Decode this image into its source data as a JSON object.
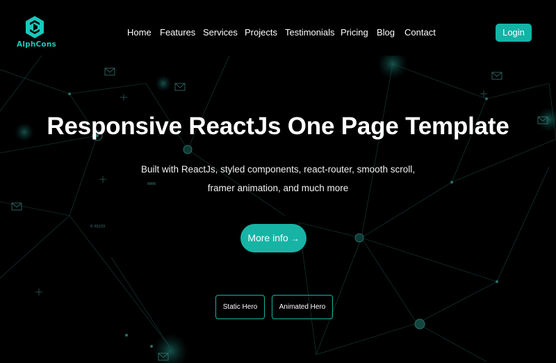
{
  "brand": {
    "name": "AlphCons",
    "logo_icon": "hexagon-logo-icon",
    "accent": "#17b4a5"
  },
  "nav": {
    "items": [
      "Home",
      "Features",
      "Services",
      "Projects",
      "Testimonials",
      "Pricing",
      "Blog",
      "Contact"
    ],
    "login_label": "Login"
  },
  "hero": {
    "title": "Responsive ReactJs One Page Template",
    "subtitle": "Built with ReactJs, styled components, react-router, smooth scroll, framer animation, and much more",
    "cta_label": "More info",
    "cta_icon": "arrow-right-icon",
    "buttons": [
      "Static Hero",
      "Animated Hero"
    ]
  },
  "background": {
    "decor_numbers": [
      "0.01233",
      "0000"
    ]
  }
}
